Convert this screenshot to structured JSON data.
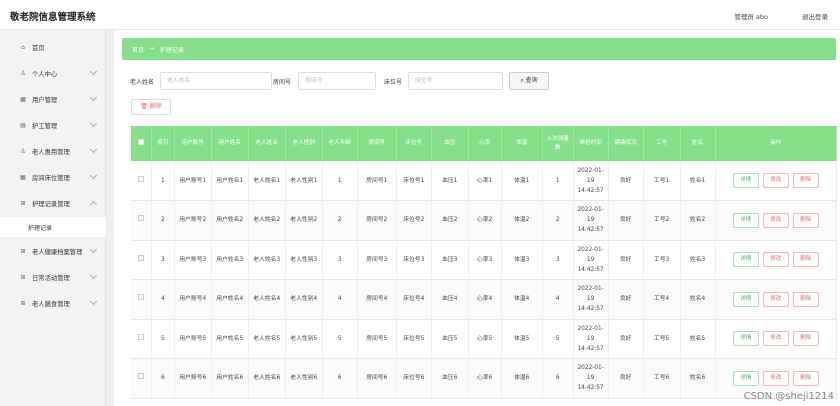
{
  "header": {
    "app_title": "敬老院信息管理系统",
    "user": "管理员 abo",
    "logout": "退出登录"
  },
  "sidebar": {
    "items": [
      {
        "label": "首页",
        "icon": "home-icon",
        "glyph": "⌂"
      },
      {
        "label": "个人中心",
        "icon": "person-icon",
        "glyph": "♙"
      },
      {
        "label": "用户管理",
        "icon": "grid-icon",
        "glyph": "▦"
      },
      {
        "label": "护工管理",
        "icon": "grid-icon",
        "glyph": "▤"
      },
      {
        "label": "老人惠用管理",
        "icon": "person-icon",
        "glyph": "♙"
      },
      {
        "label": "房间床位管理",
        "icon": "grid-icon",
        "glyph": "▦"
      },
      {
        "label": "护理记录管理",
        "icon": "apps-icon",
        "glyph": "⊞"
      },
      {
        "label": "老人健康档案管理",
        "icon": "apps-icon",
        "glyph": "⊞"
      },
      {
        "label": "日常活动管理",
        "icon": "apps-icon",
        "glyph": "⊞"
      },
      {
        "label": "老人膳食管理",
        "icon": "apps-icon",
        "glyph": "⊞"
      }
    ],
    "active_sub": "护理记录"
  },
  "breadcrumb": {
    "home": "首页",
    "sep": "→",
    "current": "护理记录"
  },
  "search": {
    "field1_label": "老人姓名",
    "field1_placeholder": "老人姓名",
    "field2_label": "房间号",
    "field2_placeholder": "房间号",
    "field3_label": "床位号",
    "field3_placeholder": "床位号",
    "button": "查询"
  },
  "actions": {
    "delete": "删除"
  },
  "table": {
    "headers": [
      "",
      "索引",
      "用户账号",
      "用户姓名",
      "老人姓名",
      "老人性别",
      "老人年龄",
      "房间号",
      "床位号",
      "血压",
      "心率",
      "体温",
      "上次测量数",
      "体检时间",
      "健康状况",
      "工号",
      "姓名",
      "操作"
    ],
    "buttons": {
      "detail": "详情",
      "edit": "修改",
      "delete": "删除"
    },
    "rows": [
      {
        "idx": "1",
        "account": "用户账号1",
        "uname": "用户姓名1",
        "ename": "老人姓名1",
        "gender": "老人性别1",
        "age": "1",
        "room": "房间号1",
        "bed": "床位号1",
        "bp": "血压1",
        "hr": "心率1",
        "temp": "体温1",
        "cnt": "1",
        "time": "2022-01-19 14:42:57",
        "health": "良好",
        "jobno": "工号1",
        "name": "姓名1"
      },
      {
        "idx": "2",
        "account": "用户账号2",
        "uname": "用户姓名2",
        "ename": "老人姓名2",
        "gender": "老人性别2",
        "age": "2",
        "room": "房间号2",
        "bed": "床位号2",
        "bp": "血压2",
        "hr": "心率2",
        "temp": "体温2",
        "cnt": "2",
        "time": "2022-01-19 14:42:57",
        "health": "良好",
        "jobno": "工号2",
        "name": "姓名2"
      },
      {
        "idx": "3",
        "account": "用户账号3",
        "uname": "用户姓名3",
        "ename": "老人姓名3",
        "gender": "老人性别3",
        "age": "3",
        "room": "房间号3",
        "bed": "床位号3",
        "bp": "血压3",
        "hr": "心率3",
        "temp": "体温3",
        "cnt": "3",
        "time": "2022-01-19 14:42:57",
        "health": "良好",
        "jobno": "工号3",
        "name": "姓名3"
      },
      {
        "idx": "4",
        "account": "用户账号4",
        "uname": "用户姓名4",
        "ename": "老人姓名4",
        "gender": "老人性别4",
        "age": "4",
        "room": "房间号4",
        "bed": "床位号4",
        "bp": "血压4",
        "hr": "心率4",
        "temp": "体温4",
        "cnt": "4",
        "time": "2022-01-19 14:42:57",
        "health": "良好",
        "jobno": "工号4",
        "name": "姓名4"
      },
      {
        "idx": "5",
        "account": "用户账号5",
        "uname": "用户姓名5",
        "ename": "老人姓名5",
        "gender": "老人性别5",
        "age": "5",
        "room": "房间号5",
        "bed": "床位号5",
        "bp": "血压5",
        "hr": "心率5",
        "temp": "体温5",
        "cnt": "5",
        "time": "2022-01-19 14:42:57",
        "health": "良好",
        "jobno": "工号5",
        "name": "姓名5"
      },
      {
        "idx": "6",
        "account": "用户账号6",
        "uname": "用户姓名6",
        "ename": "老人姓名6",
        "gender": "老人性别6",
        "age": "6",
        "room": "房间号6",
        "bed": "床位号6",
        "bp": "血压6",
        "hr": "心率6",
        "temp": "体温6",
        "cnt": "6",
        "time": "2022-01-19 14:42:57",
        "health": "良好",
        "jobno": "工号6",
        "name": "姓名6"
      }
    ]
  },
  "watermark": "CSDN @sheji1214",
  "colors": {
    "accent": "#86e08a",
    "danger": "#e06b6b",
    "detail": "#47b06f"
  }
}
